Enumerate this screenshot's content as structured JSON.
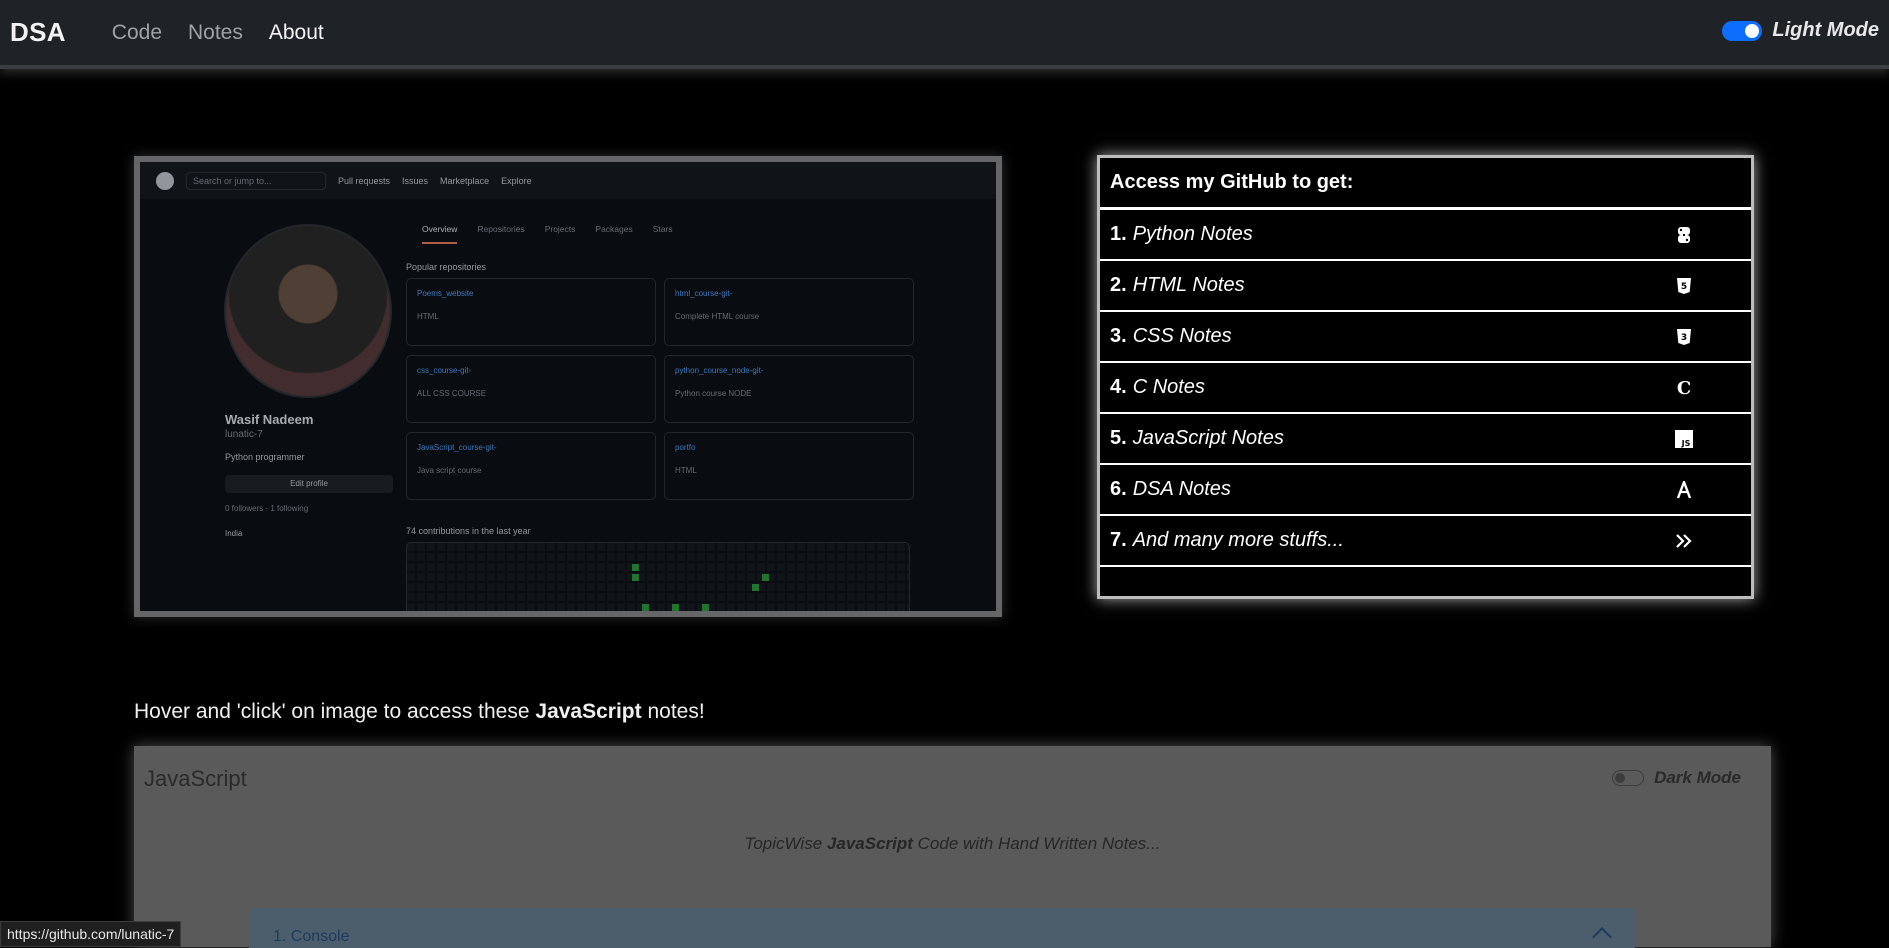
{
  "navbar": {
    "brand": "DSA",
    "links": [
      {
        "label": "Code",
        "active": false
      },
      {
        "label": "Notes",
        "active": false
      },
      {
        "label": "About",
        "active": true
      }
    ],
    "mode_label": "Light Mode",
    "mode_toggle_on": true,
    "accent": "#0d6efd"
  },
  "github_preview": {
    "search_placeholder": "Search or jump to...",
    "top_links": [
      "Pull requests",
      "Issues",
      "Marketplace",
      "Explore"
    ],
    "tabs": [
      "Overview",
      "Repositories",
      "Projects",
      "Packages",
      "Stars"
    ],
    "name": "Wasif Nadeem",
    "handle": "lunatic-7",
    "bio": "Python programmer",
    "edit_label": "Edit profile",
    "followers": "0 followers · 1 following",
    "location": "India",
    "popular_label": "Popular repositories",
    "repos": [
      {
        "name": "Poems_website",
        "desc": "HTML"
      },
      {
        "name": "html_course-git-",
        "desc": "Complete HTML course"
      },
      {
        "name": "css_course-git-",
        "desc": "ALL CSS COURSE"
      },
      {
        "name": "python_course_node-git-",
        "desc": "Python course NODE"
      },
      {
        "name": "JavaScript_course-git-",
        "desc": "Java script course"
      },
      {
        "name": "portfo",
        "desc": "HTML"
      }
    ],
    "contrib_label": "74 contributions in the last year"
  },
  "notes_card": {
    "heading": "Access my GitHub to get:",
    "items": [
      {
        "num": "1.",
        "label": "Python Notes",
        "icon": "python-icon"
      },
      {
        "num": "2.",
        "label": "HTML Notes",
        "icon": "html5-icon"
      },
      {
        "num": "3.",
        "label": "CSS Notes",
        "icon": "css3-icon"
      },
      {
        "num": "4.",
        "label": "C Notes",
        "icon": "c-icon"
      },
      {
        "num": "5.",
        "label": "JavaScript Notes",
        "icon": "js-icon"
      },
      {
        "num": "6.",
        "label": "DSA Notes",
        "icon": "dsa-icon"
      },
      {
        "num": "7.",
        "label": "And many more stuffs...",
        "icon": "double-chevron-right-icon"
      }
    ]
  },
  "hover_text": {
    "prefix": "Hover and 'click' on image to access these ",
    "bold": "JavaScript",
    "suffix": " notes!"
  },
  "js_panel": {
    "title": "JavaScript",
    "dark_mode_label": "Dark Mode",
    "subtitle_prefix": "TopicWise ",
    "subtitle_bold": "JavaScript",
    "subtitle_suffix": " Code with Hand Written Notes...",
    "accordion_first": "1. Console"
  },
  "status_bar": {
    "url": "https://github.com/lunatic-7"
  }
}
